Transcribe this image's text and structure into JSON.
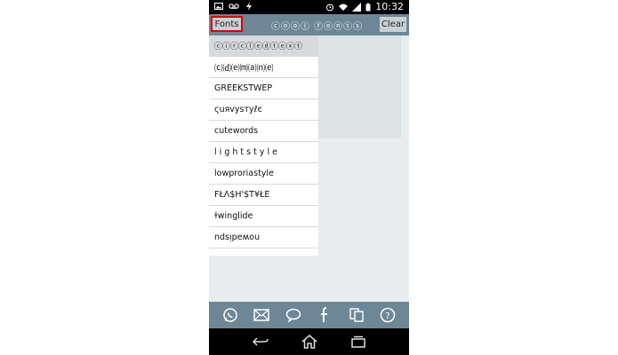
{
  "statusbar": {
    "time": "10:32"
  },
  "appbar": {
    "fonts_label": "Fonts",
    "title": "ⓒⓞⓞⓛ ⓕⓞⓝⓣⓢ",
    "clear_label": "Clear"
  },
  "font_list": [
    {
      "label": "ⓒⓘⓡⓒⓛⓔⓓⓣⓔⓧⓣ"
    },
    {
      "label": "⒞⒟⒠⒨⒜⒩⒠"
    },
    {
      "label": "GREEKSTWEP"
    },
    {
      "label": "ςuяvysтyℓє"
    },
    {
      "label": "cutewords"
    },
    {
      "label": "l i g h t s t y l e"
    },
    {
      "label": "lowproriastyle"
    },
    {
      "label": "FŁΛ$H'$T¥ŁE"
    },
    {
      "label": "ɫwinglide"
    },
    {
      "label": "ndsᴉpeʍou"
    }
  ],
  "bottom_icons": [
    "whatsapp-icon",
    "mail-icon",
    "chat-bubble-icon",
    "facebook-icon",
    "copy-icon",
    "help-icon"
  ],
  "nav_icons": [
    "back-icon",
    "home-icon",
    "recents-icon"
  ],
  "colors": {
    "appbar": "#6d8797",
    "highlight": "#e00000"
  }
}
